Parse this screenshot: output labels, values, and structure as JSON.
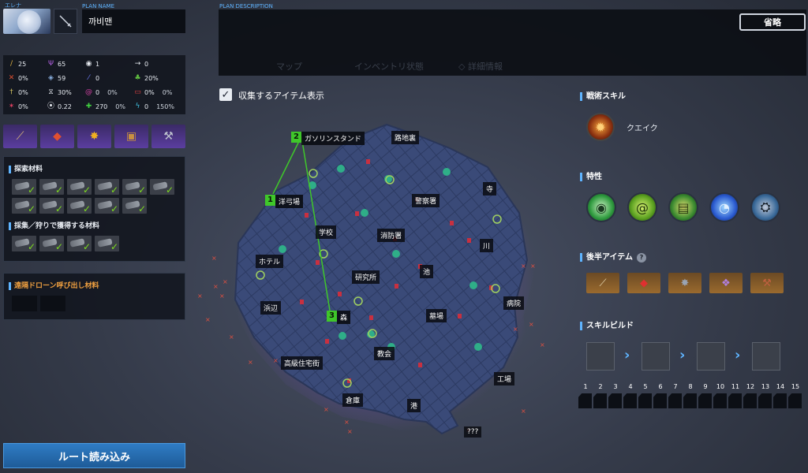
{
  "character": {
    "name": "エレナ"
  },
  "plan": {
    "name_label": "PLAN NAME",
    "name_value": "까비맨",
    "description_label": "PLAN DESCRIPTION",
    "ghost_tabs": "マップ　　　　　　インベントリ状態　　　　◇ 詳細情報",
    "abbreviate_button": "省略"
  },
  "stats": [
    {
      "icon": "sword-icon",
      "value": "25"
    },
    {
      "icon": "trident-icon",
      "value": "65"
    },
    {
      "icon": "eye-icon",
      "value": "1"
    },
    {
      "icon": "arrow-right-icon",
      "value": "0"
    },
    {
      "icon": "crossed-swords-icon",
      "value": "0%"
    },
    {
      "icon": "shield-icon",
      "value": "59"
    },
    {
      "icon": "slash-icon",
      "value": "0"
    },
    {
      "icon": "heal-icon",
      "value": "20%"
    },
    {
      "icon": "dagger-icon",
      "value": "0%"
    },
    {
      "icon": "hourglass-icon",
      "value": "30%"
    },
    {
      "icon": "vortex-icon",
      "value": "0",
      "extra": "0%"
    },
    {
      "icon": "bracket-icon",
      "value": "0%",
      "extra": "0%"
    },
    {
      "icon": "burst-icon",
      "value": "0%"
    },
    {
      "icon": "boot-icon",
      "value": "0.22"
    },
    {
      "icon": "plus-icon",
      "value": "270",
      "extra": "0%"
    },
    {
      "icon": "lightning-icon",
      "value": "0",
      "extra": "150%"
    }
  ],
  "materials": {
    "exploration_title": "探索材料",
    "gather_title": "採集／狩りで獲得する材料",
    "drone_title": "遠隔ドローン呼び出し材料"
  },
  "route_button": "ルート読み込み",
  "map": {
    "show_items_label": "収集するアイテム表示",
    "route_points": [
      {
        "num": "1",
        "name": "洋弓場"
      },
      {
        "num": "2",
        "name": "ガソリンスタンド"
      },
      {
        "num": "3",
        "name": "森"
      }
    ],
    "locations": [
      "路地裏",
      "寺",
      "警察署",
      "学校",
      "消防署",
      "川",
      "ホテル",
      "研究所",
      "池",
      "病院",
      "浜辺",
      "墓場",
      "教会",
      "高級住宅街",
      "工場",
      "倉庫",
      "港",
      "???"
    ]
  },
  "right": {
    "tactical_title": "戦術スキル",
    "tactical_skill": "クエイク",
    "traits_title": "特性",
    "late_items_title": "後半アイテム",
    "skill_build_title": "スキルビルド",
    "levels": [
      "1",
      "2",
      "3",
      "4",
      "5",
      "6",
      "7",
      "8",
      "9",
      "10",
      "11",
      "12",
      "13",
      "14",
      "15"
    ]
  }
}
